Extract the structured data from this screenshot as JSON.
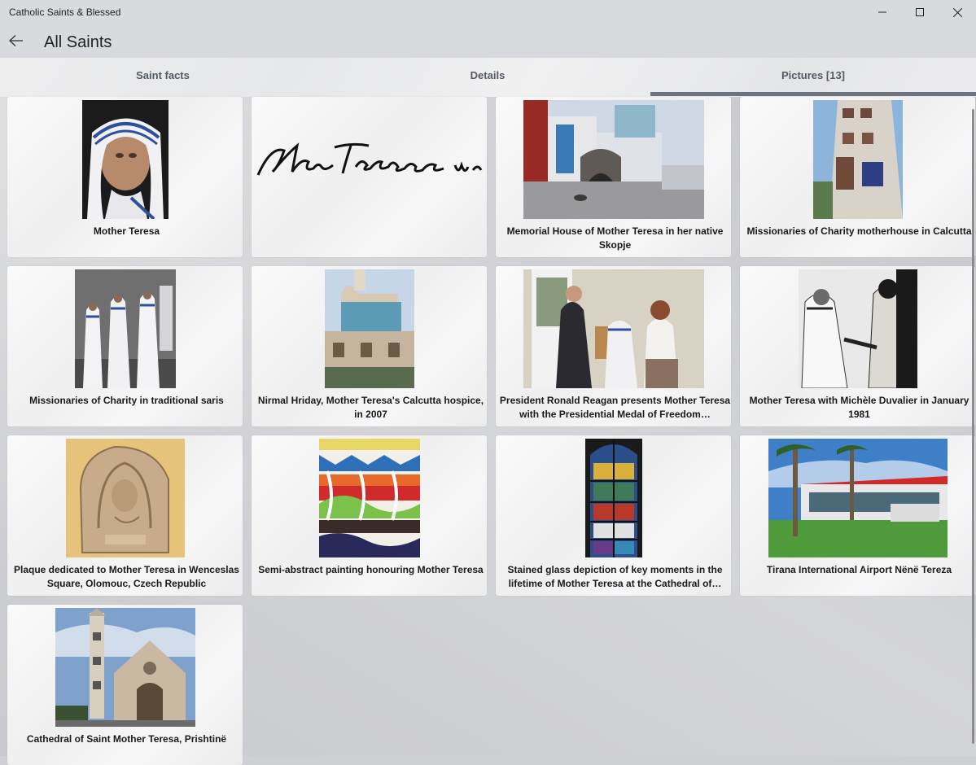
{
  "window": {
    "title": "Catholic Saints & Blessed",
    "controls": [
      "minimize",
      "maximize",
      "close"
    ]
  },
  "header": {
    "title": "All Saints"
  },
  "tabs": [
    {
      "label": "Saint facts"
    },
    {
      "label": "Details"
    },
    {
      "label": "Pictures [13]"
    }
  ],
  "pictures": [
    {
      "caption": "Mother Teresa"
    },
    {
      "caption": ""
    },
    {
      "caption": "Memorial House of Mother Teresa in her native Skopje"
    },
    {
      "caption": "Missionaries of Charity motherhouse in Calcutta"
    },
    {
      "caption": "Missionaries of Charity in traditional saris"
    },
    {
      "caption": "Nirmal Hriday, Mother Teresa's Calcutta hospice, in 2007"
    },
    {
      "caption": "President Ronald Reagan presents Mother Teresa with the Presidential Medal of Freedom…"
    },
    {
      "caption": "Mother Teresa with Michèle Duvalier in January 1981"
    },
    {
      "caption": "Plaque dedicated to Mother Teresa in Wenceslas Square, Olomouc, Czech Republic"
    },
    {
      "caption": "Semi-abstract painting honouring Mother Teresa"
    },
    {
      "caption": "Stained glass depiction of key moments in the lifetime of Mother Teresa at the Cathedral of…"
    },
    {
      "caption": "Tirana International Airport Nënë Tereza"
    },
    {
      "caption": "Cathedral of Saint Mother Teresa, Prishtinë"
    }
  ],
  "signature_text": "Mother Teresa"
}
